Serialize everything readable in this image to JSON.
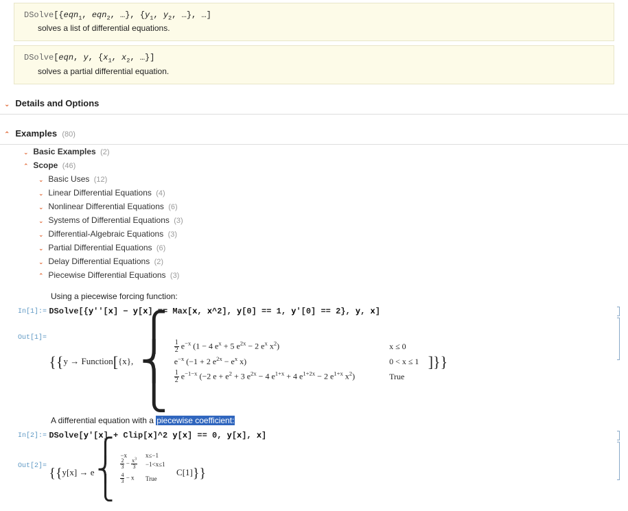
{
  "usage_boxes": {
    "box1": {
      "syntax": "DSolve[{eqn₁, eqn₂, …}, {y₁, y₂, …}, …]",
      "desc": "solves a list of differential equations."
    },
    "box2": {
      "syntax": "DSolve[eqn, y, {x₁, x₂, …}]",
      "desc": "solves a partial differential equation."
    }
  },
  "sections": {
    "details": {
      "title": "Details and Options",
      "open": false
    },
    "examples": {
      "title": "Examples",
      "count": "(80)",
      "open": true
    }
  },
  "subsections": {
    "basic_examples": {
      "title": "Basic Examples",
      "count": "(2)",
      "open": false
    },
    "scope": {
      "title": "Scope",
      "count": "(46)",
      "open": true
    }
  },
  "scope_items": {
    "basic_uses": {
      "title": "Basic Uses",
      "count": "(12)",
      "open": false
    },
    "linear_de": {
      "title": "Linear Differential Equations",
      "count": "(4)",
      "open": false
    },
    "nonlinear_de": {
      "title": "Nonlinear Differential Equations",
      "count": "(6)",
      "open": false
    },
    "systems_de": {
      "title": "Systems of Differential Equations",
      "count": "(3)",
      "open": false
    },
    "algebraic_de": {
      "title": "Differential-Algebraic Equations",
      "count": "(3)",
      "open": false
    },
    "partial_de": {
      "title": "Partial Differential Equations",
      "count": "(6)",
      "open": false
    },
    "delay_de": {
      "title": "Delay Differential Equations",
      "count": "(2)",
      "open": false
    },
    "piecewise_de": {
      "title": "Piecewise Differential Equations",
      "count": "(3)",
      "open": true
    }
  },
  "example1": {
    "intro": "Using a piecewise forcing function:",
    "in_label": "In[1]:=",
    "in_code": "DSolve[{y''[x] - y[x] == Max[x, x^2], y[0] == 1, y'[0] == 2}, y, x]",
    "out_label": "Out[1]=",
    "out_prefix": "{{y → Function[{x}, ",
    "out_rows": [
      {
        "expr": "½ e⁻ˣ (1 − 4 eˣ + 5 e²ˣ − 2 eˣ x²)",
        "cond": "x ≤ 0"
      },
      {
        "expr": "e⁻ˣ (−1 + 2 e²ˣ − eˣ x)",
        "cond": "0 < x ≤ 1"
      },
      {
        "expr": "½ e⁻¹⁻ˣ (−2 e + e² + 3 e²ˣ − 4 e¹⁺ˣ + 4 e¹⁺²ˣ − 2 e¹⁺ˣ x²)",
        "cond": "True"
      }
    ],
    "out_suffix": "]}}"
  },
  "example2": {
    "intro_pre": "A differential equation with a ",
    "intro_hl": "piecewise coefficient:",
    "in_label": "In[2]:=",
    "in_code": "DSolve[y'[x] + Clip[x]^2 y[x] == 0, y[x], x]",
    "out_label": "Out[2]=",
    "out_prefix": "{{y[x] → e",
    "exp_rows": [
      {
        "expr": "−x",
        "cond": "x≤−1"
      },
      {
        "expr": "²⁄₃ − x³⁄₃",
        "cond": "−1<x≤1"
      },
      {
        "expr": "⁴⁄₃ − x",
        "cond": "True"
      }
    ],
    "out_suffix": " C[1]}}"
  }
}
